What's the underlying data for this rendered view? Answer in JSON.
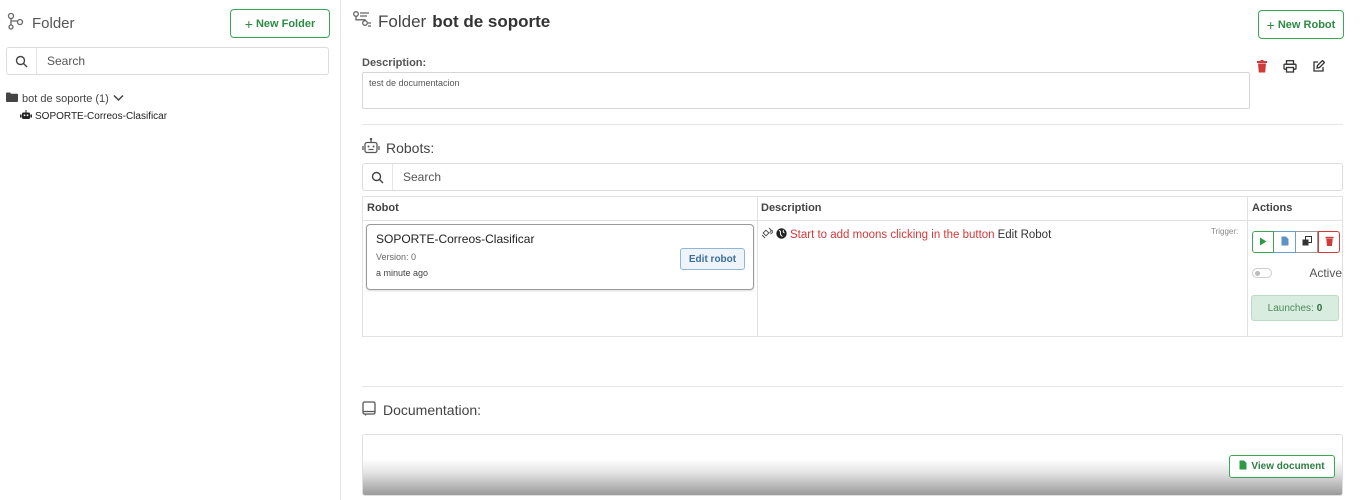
{
  "sidebar": {
    "title": "Folder",
    "new_folder_label": "New Folder",
    "search_placeholder": "Search",
    "tree": {
      "folder_label": "bot de soporte (1)",
      "items": [
        {
          "label": "SOPORTE-Correos-Clasificar"
        }
      ]
    }
  },
  "main": {
    "title_prefix": "Folder",
    "folder_name": "bot de soporte",
    "new_robot_label": "New Robot",
    "description_label": "Description:",
    "description_value": "test de documentacion",
    "robots_title": "Robots:",
    "robots_search_placeholder": "Search",
    "table": {
      "headers": {
        "robot": "Robot",
        "description": "Description",
        "actions": "Actions"
      },
      "rows": [
        {
          "name": "SOPORTE-Correos-Clasificar",
          "version": "Version: 0",
          "time": "a minute ago",
          "edit_label": "Edit robot",
          "description_red": "Start to add moons clicking in the button",
          "description_dark": "Edit Robot",
          "trigger_label": "Trigger:",
          "active_label": "Active",
          "launches_label": "Launches:",
          "launches_count": "0"
        }
      ]
    },
    "documentation_title": "Documentation:",
    "view_document_label": "View document"
  },
  "colors": {
    "green": "#3aa853",
    "red": "#d13a3a",
    "blue": "#6a9fd1"
  }
}
